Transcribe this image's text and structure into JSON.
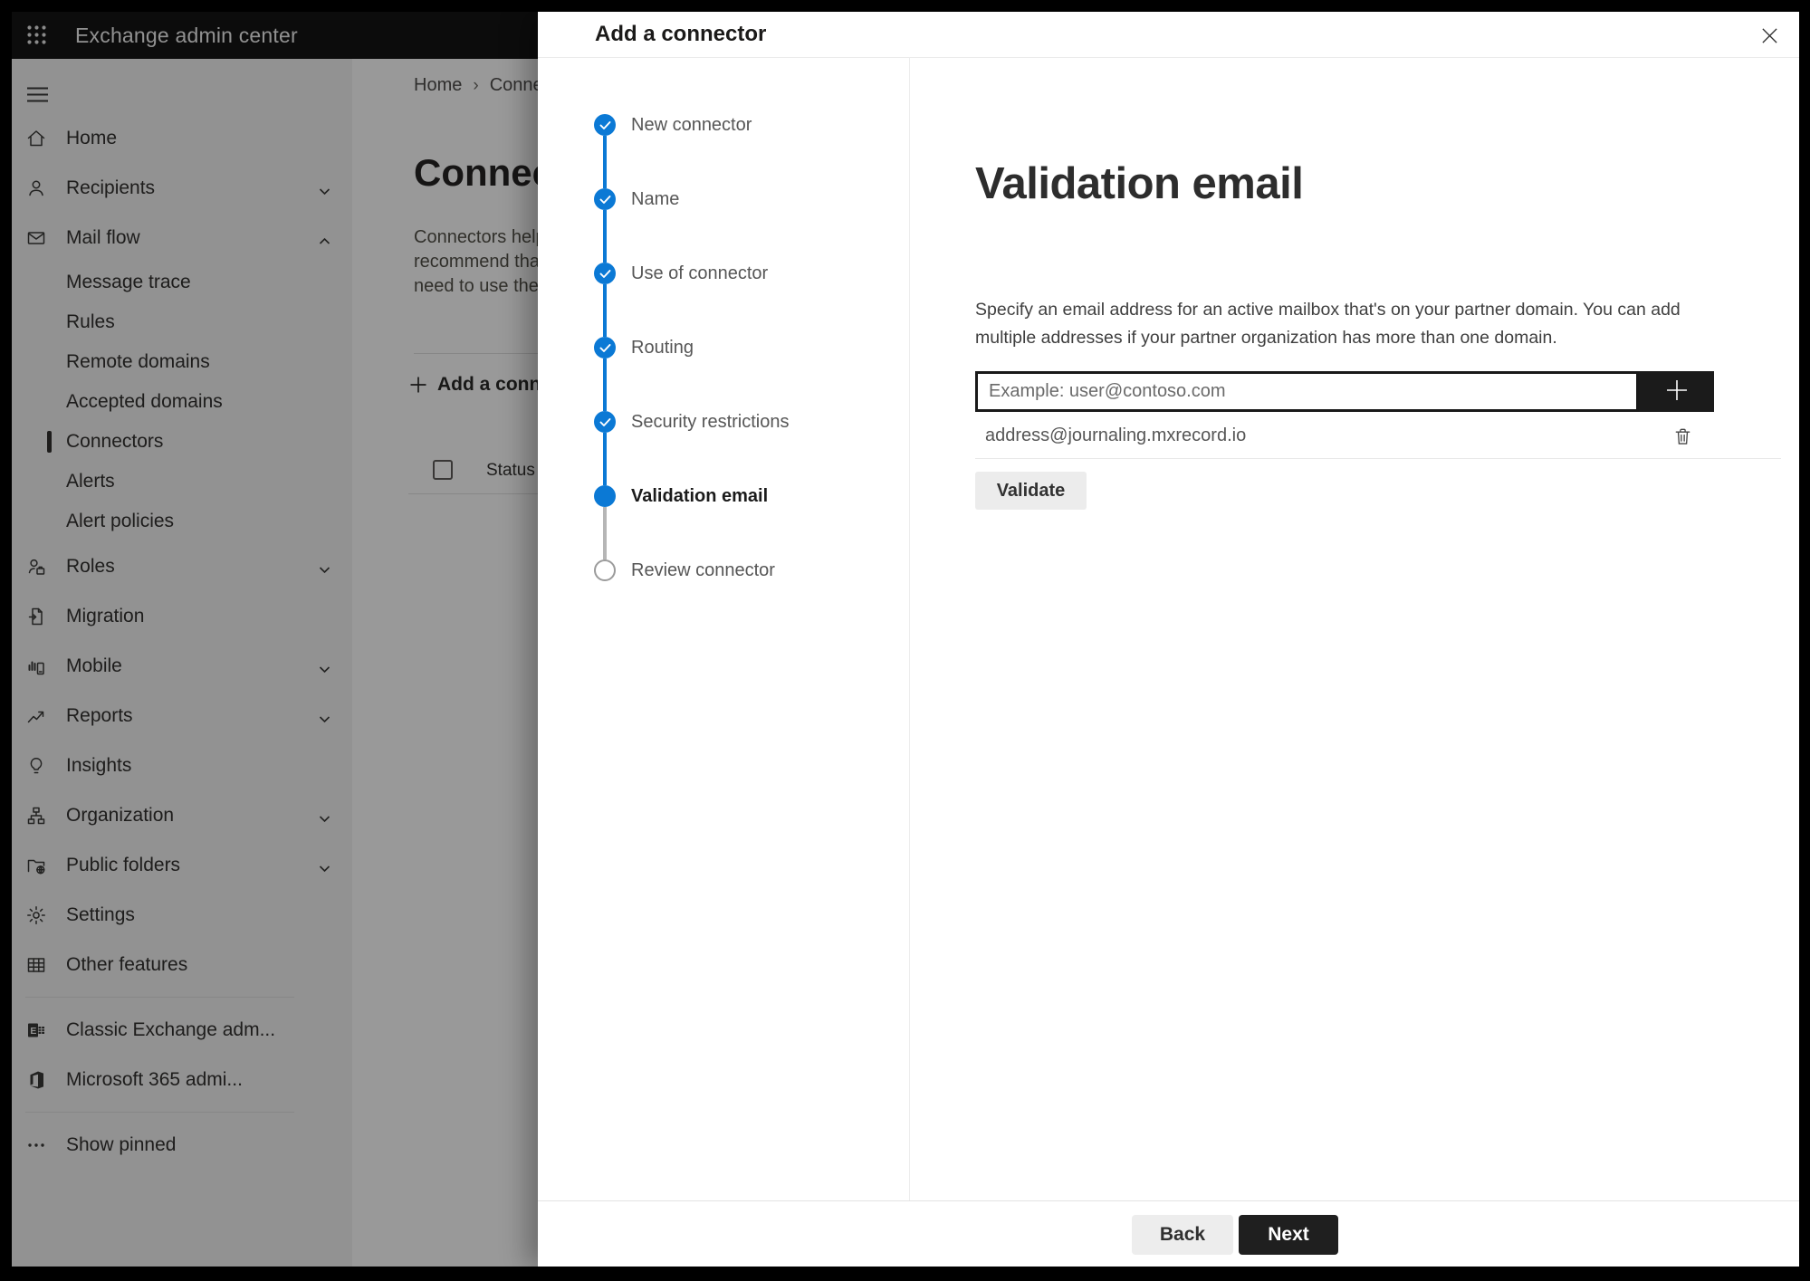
{
  "topbar": {
    "title": "Exchange admin center"
  },
  "sidebar": {
    "items": [
      {
        "label": "Home",
        "icon": "home-icon",
        "type": "top"
      },
      {
        "label": "Recipients",
        "icon": "person-icon",
        "type": "top",
        "chevron": "down"
      },
      {
        "label": "Mail flow",
        "icon": "mail-icon",
        "type": "top",
        "chevron": "up"
      },
      {
        "label": "Message trace",
        "type": "sub"
      },
      {
        "label": "Rules",
        "type": "sub"
      },
      {
        "label": "Remote domains",
        "type": "sub"
      },
      {
        "label": "Accepted domains",
        "type": "sub"
      },
      {
        "label": "Connectors",
        "type": "sub",
        "selected": true
      },
      {
        "label": "Alerts",
        "type": "sub"
      },
      {
        "label": "Alert policies",
        "type": "sub"
      },
      {
        "label": "Roles",
        "icon": "roles-icon",
        "type": "top",
        "chevron": "down"
      },
      {
        "label": "Migration",
        "icon": "migration-icon",
        "type": "top"
      },
      {
        "label": "Mobile",
        "icon": "mobile-icon",
        "type": "top",
        "chevron": "down"
      },
      {
        "label": "Reports",
        "icon": "reports-icon",
        "type": "top",
        "chevron": "down"
      },
      {
        "label": "Insights",
        "icon": "insights-icon",
        "type": "top"
      },
      {
        "label": "Organization",
        "icon": "organization-icon",
        "type": "top",
        "chevron": "down"
      },
      {
        "label": "Public folders",
        "icon": "public-folders-icon",
        "type": "top",
        "chevron": "down"
      },
      {
        "label": "Settings",
        "icon": "settings-icon",
        "type": "top"
      },
      {
        "label": "Other features",
        "icon": "other-features-icon",
        "type": "top"
      },
      {
        "type": "divider"
      },
      {
        "label": "Classic Exchange adm...",
        "icon": "classic-exchange-icon",
        "type": "top"
      },
      {
        "label": "Microsoft 365 admi...",
        "icon": "microsoft-365-icon",
        "type": "top"
      },
      {
        "type": "divider"
      },
      {
        "label": "Show pinned",
        "icon": "ellipsis-icon",
        "type": "top"
      }
    ]
  },
  "background": {
    "breadcrumb": {
      "home": "Home",
      "separator": "›",
      "current": "Connectors"
    },
    "heading": "Connectors",
    "description": "Connectors help control the flow of email messages to and from your organization. We\nrecommend that you check to see if you need to create a connector, since most organizations\nneed to use them.",
    "add_button_label": "Add a connector",
    "table": {
      "columns": [
        "Status"
      ]
    }
  },
  "panel": {
    "title": "Add a connector",
    "steps": [
      {
        "label": "New connector",
        "state": "completed"
      },
      {
        "label": "Name",
        "state": "completed"
      },
      {
        "label": "Use of connector",
        "state": "completed"
      },
      {
        "label": "Routing",
        "state": "completed"
      },
      {
        "label": "Security restrictions",
        "state": "completed"
      },
      {
        "label": "Validation email",
        "state": "current"
      },
      {
        "label": "Review connector",
        "state": "upcoming"
      }
    ],
    "content": {
      "heading": "Validation email",
      "description": "Specify an email address for an active mailbox that's on your partner domain. You can add\nmultiple addresses if your partner organization has more than one domain.",
      "email_input": {
        "placeholder": "Example: user@contoso.com",
        "value": ""
      },
      "addresses": [
        "address@journaling.mxrecord.io"
      ],
      "validate_button_label": "Validate"
    },
    "footer": {
      "back_button_label": "Back",
      "next_button_label": "Next"
    }
  },
  "colors": {
    "accent_blue": "#0b79d5",
    "topbar_black": "#141414",
    "button_dark": "#1f1f1f"
  }
}
